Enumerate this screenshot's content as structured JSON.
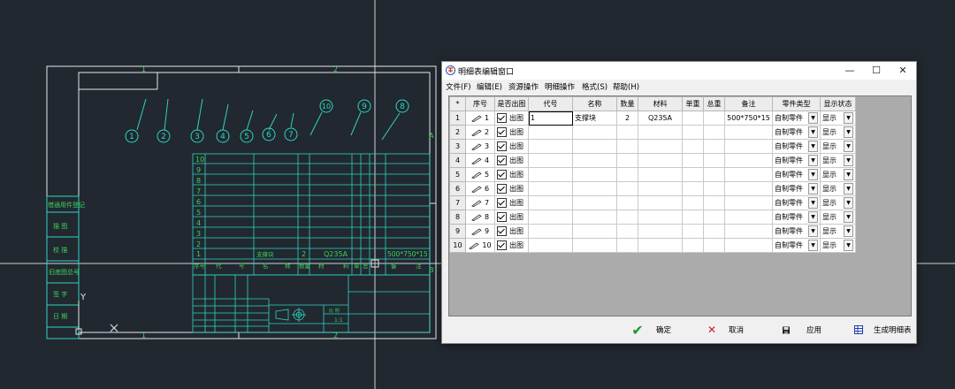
{
  "cad": {
    "zone_numbers_top": [
      "1",
      "2"
    ],
    "zone_numbers_bottom": [
      "1",
      "2"
    ],
    "zone_letters_right": [
      "A",
      "B"
    ],
    "balloons": [
      "1",
      "2",
      "3",
      "4",
      "5",
      "6",
      "7",
      "10",
      "9",
      "8"
    ],
    "left_labels": [
      "借通用件登记",
      "描 图",
      "校 描",
      "旧底图总号",
      "签 字",
      "日 期"
    ],
    "bom_row_numbers": [
      "10",
      "9",
      "8",
      "7",
      "6",
      "5",
      "4",
      "3",
      "2"
    ],
    "bom_row1": {
      "index": "1",
      "name": "支撑块",
      "qty": "2",
      "material": "Q235A",
      "remark": "500*750*15"
    },
    "bom_header": [
      "序号",
      "代",
      "号",
      "名",
      "称",
      "数量",
      "材",
      "料",
      "单",
      "总",
      "备",
      "注"
    ],
    "title_block": [
      "比 例",
      "1:1"
    ],
    "axis_label": "Y",
    "colors": {
      "background": "#212830",
      "frame": "#e8e8e8",
      "cad_green": "#3fd15a",
      "cad_cyan": "#2fd4c0"
    }
  },
  "dialog": {
    "title": "明细表编辑窗口",
    "window_buttons": {
      "minimize": "—",
      "maximize": "☐",
      "close": "✕"
    },
    "menu": [
      "文件(F)",
      "编辑(E)",
      "资源操作",
      "明细操作",
      "格式(S)",
      "帮助(H)"
    ],
    "columns": [
      "*",
      "序号",
      "是否出图",
      "代号",
      "名称",
      "数量",
      "材料",
      "单重",
      "总重",
      "备注",
      "零件类型",
      "显示状态"
    ],
    "rows": [
      {
        "row": "1",
        "seq": "1",
        "out": "出图",
        "code": "1",
        "name": "支撑块",
        "qty": "2",
        "material": "Q235A",
        "unit": "",
        "total": "",
        "remark": "500*750*15",
        "type": "自制零件",
        "status": "显示"
      },
      {
        "row": "2",
        "seq": "2",
        "out": "出图",
        "code": "",
        "name": "",
        "qty": "",
        "material": "",
        "unit": "",
        "total": "",
        "remark": "",
        "type": "自制零件",
        "status": "显示"
      },
      {
        "row": "3",
        "seq": "3",
        "out": "出图",
        "code": "",
        "name": "",
        "qty": "",
        "material": "",
        "unit": "",
        "total": "",
        "remark": "",
        "type": "自制零件",
        "status": "显示"
      },
      {
        "row": "4",
        "seq": "4",
        "out": "出图",
        "code": "",
        "name": "",
        "qty": "",
        "material": "",
        "unit": "",
        "total": "",
        "remark": "",
        "type": "自制零件",
        "status": "显示"
      },
      {
        "row": "5",
        "seq": "5",
        "out": "出图",
        "code": "",
        "name": "",
        "qty": "",
        "material": "",
        "unit": "",
        "total": "",
        "remark": "",
        "type": "自制零件",
        "status": "显示"
      },
      {
        "row": "6",
        "seq": "6",
        "out": "出图",
        "code": "",
        "name": "",
        "qty": "",
        "material": "",
        "unit": "",
        "total": "",
        "remark": "",
        "type": "自制零件",
        "status": "显示"
      },
      {
        "row": "7",
        "seq": "7",
        "out": "出图",
        "code": "",
        "name": "",
        "qty": "",
        "material": "",
        "unit": "",
        "total": "",
        "remark": "",
        "type": "自制零件",
        "status": "显示"
      },
      {
        "row": "8",
        "seq": "8",
        "out": "出图",
        "code": "",
        "name": "",
        "qty": "",
        "material": "",
        "unit": "",
        "total": "",
        "remark": "",
        "type": "自制零件",
        "status": "显示"
      },
      {
        "row": "9",
        "seq": "9",
        "out": "出图",
        "code": "",
        "name": "",
        "qty": "",
        "material": "",
        "unit": "",
        "total": "",
        "remark": "",
        "type": "自制零件",
        "status": "显示"
      },
      {
        "row": "10",
        "seq": "10",
        "out": "出图",
        "code": "",
        "name": "",
        "qty": "",
        "material": "",
        "unit": "",
        "total": "",
        "remark": "",
        "type": "自制零件",
        "status": "显示"
      }
    ],
    "buttons": {
      "ok": "确定",
      "cancel": "取消",
      "apply": "应用",
      "generate": "生成明细表"
    },
    "icons": {
      "ok": "check-icon",
      "cancel": "cross-icon",
      "apply": "save-icon",
      "generate": "table-generate-icon",
      "app": "app-logo-icon",
      "row_edit": "pen-icon"
    }
  }
}
